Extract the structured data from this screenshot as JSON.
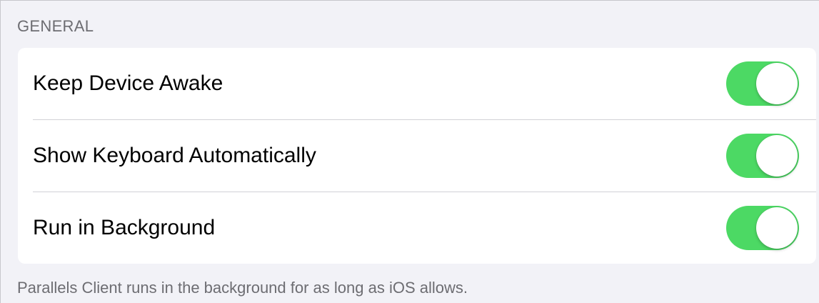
{
  "section": {
    "header": "GENERAL",
    "footer": "Parallels Client runs in the background for as long as iOS allows."
  },
  "settings": [
    {
      "label": "Keep Device Awake",
      "enabled": true
    },
    {
      "label": "Show Keyboard Automatically",
      "enabled": true
    },
    {
      "label": "Run in Background",
      "enabled": true
    }
  ],
  "colors": {
    "toggle_on": "#4cd964",
    "background": "#f2f2f7",
    "secondary_text": "#6d6d72"
  }
}
